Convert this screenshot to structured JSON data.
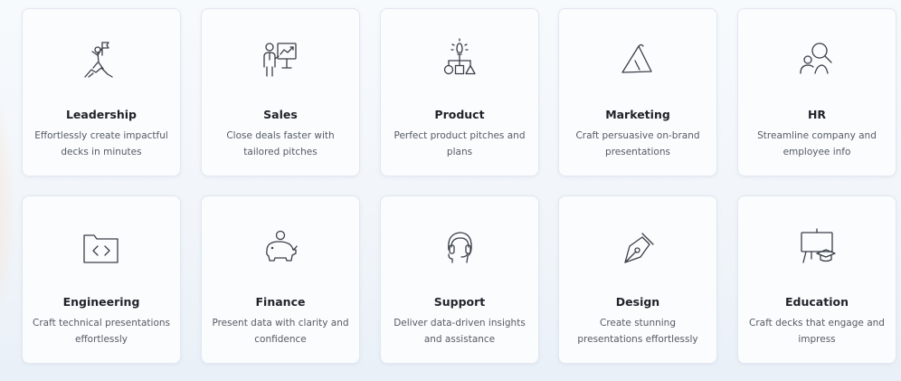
{
  "cards": [
    {
      "title": "Leadership",
      "desc": "Effortlessly create impactful decks in minutes",
      "icon": "summit-flag-icon"
    },
    {
      "title": "Sales",
      "desc": "Close deals faster with tailored pitches",
      "icon": "presenter-chart-icon"
    },
    {
      "title": "Product",
      "desc": "Perfect product pitches and plans",
      "icon": "idea-shapes-icon"
    },
    {
      "title": "Marketing",
      "desc": "Craft persuasive on-brand presentations",
      "icon": "megaphone-icon"
    },
    {
      "title": "HR",
      "desc": "Streamline company and employee info",
      "icon": "people-search-icon"
    },
    {
      "title": "Engineering",
      "desc": "Craft technical presentations effortlessly",
      "icon": "code-folder-icon"
    },
    {
      "title": "Finance",
      "desc": "Present data with clarity and confidence",
      "icon": "piggy-bank-icon"
    },
    {
      "title": "Support",
      "desc": "Deliver data-driven insights and assistance",
      "icon": "headset-icon"
    },
    {
      "title": "Design",
      "desc": "Create stunning presentations effortlessly",
      "icon": "pen-nib-icon"
    },
    {
      "title": "Education",
      "desc": "Craft decks that engage and impress",
      "icon": "board-graduation-icon"
    }
  ]
}
